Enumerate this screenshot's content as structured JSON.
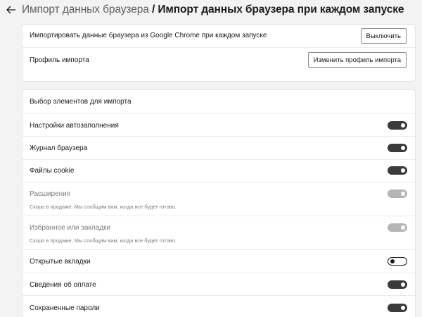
{
  "header": {
    "breadcrumb_parent": "Импорт данных браузера",
    "separator": " / ",
    "current": "Импорт данных браузера при каждом запуске"
  },
  "import_settings": {
    "chrome_label": "Импортировать данные браузера из Google Chrome при каждом запуске",
    "chrome_button": "Выключить",
    "profile_label": "Профиль импорта",
    "profile_button": "Изменить профиль импорта"
  },
  "items_section": {
    "heading": "Выбор элементов для импорта",
    "items": [
      {
        "label": "Настройки автозаполнения",
        "sub": "",
        "state": "on"
      },
      {
        "label": "Журнал браузера",
        "sub": "",
        "state": "on"
      },
      {
        "label": "Файлы cookie",
        "sub": "",
        "state": "on"
      },
      {
        "label": "Расширения",
        "sub": "Скоро в продаже. Мы сообщим вам, когда все будет готово.",
        "state": "disabled"
      },
      {
        "label": "Избранное или закладки",
        "sub": "Скоро в продаже. Мы сообщим вам, когда все будет готово.",
        "state": "disabled"
      },
      {
        "label": "Открытые вкладки",
        "sub": "",
        "state": "off"
      },
      {
        "label": "Сведения об оплате",
        "sub": "",
        "state": "on"
      },
      {
        "label": "Сохраненные пароли",
        "sub": "",
        "state": "on"
      }
    ]
  },
  "colors": {
    "toggle_on": "#3b3b3b",
    "toggle_disabled": "#b5b5b5",
    "background": "#f3f3f3"
  }
}
